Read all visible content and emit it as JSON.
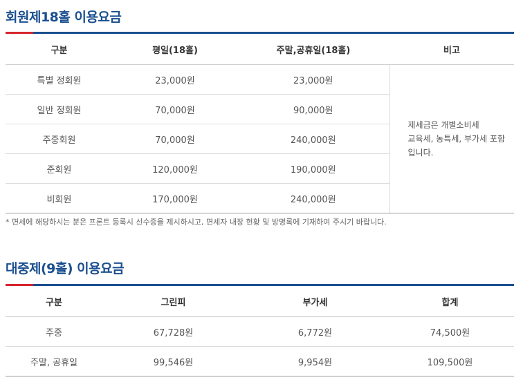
{
  "member": {
    "title": "회원제18홀 이용요금",
    "headers": [
      "구분",
      "평일(18홀)",
      "주말,공휴일(18홀)",
      "비고"
    ],
    "rows": [
      {
        "category": "특별 정회원",
        "weekday": "23,000원",
        "weekend": "23,000원"
      },
      {
        "category": "일반 정회원",
        "weekday": "70,000원",
        "weekend": "90,000원"
      },
      {
        "category": "주중회원",
        "weekday": "70,000원",
        "weekend": "240,000원"
      },
      {
        "category": "준회원",
        "weekday": "120,000원",
        "weekend": "190,000원"
      },
      {
        "category": "비회원",
        "weekday": "170,000원",
        "weekend": "240,000원"
      }
    ],
    "note_lines": [
      "제세금은 개별소비세",
      "교육세, 농특세, 부가세 포함",
      "입니다."
    ],
    "footnote": "* 면세에 해당하시는 분은 프론트 등록시 선수증을 제시하시고, 면세자 내장 현황 및 방명록에 기재하여 주시기 바랍니다."
  },
  "public": {
    "title": "대중제(9홀) 이용요금",
    "headers": [
      "구분",
      "그린피",
      "부가세",
      "합계"
    ],
    "rows": [
      {
        "category": "주중",
        "green_fee": "67,728원",
        "vat": "6,772원",
        "total": "74,500원"
      },
      {
        "category": "주말, 공휴일",
        "green_fee": "99,546원",
        "vat": "9,954원",
        "total": "109,500원"
      }
    ]
  },
  "colors": {
    "title": "#1a4f8f",
    "accent": "#d7262e"
  }
}
